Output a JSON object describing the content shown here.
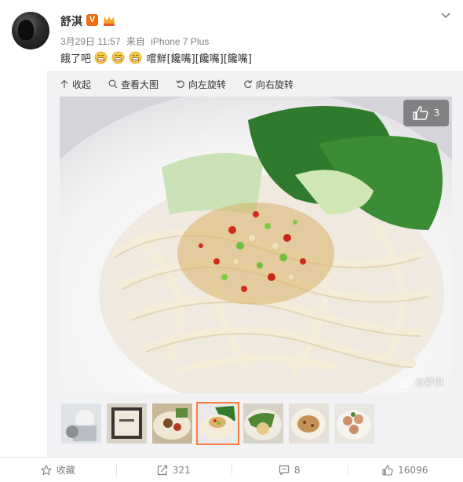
{
  "post": {
    "user": {
      "name": "舒淇",
      "verified_badge": "V"
    },
    "meta": {
      "date": "3月29日 11:57",
      "source_prefix": "来自",
      "device": "iPhone 7 Plus"
    },
    "text_parts": [
      "餓了吧",
      "嚐鮮[饞嘴][饞嘴][饞嘴]"
    ],
    "emoji": "grin-emoji"
  },
  "toolbar": {
    "collapse": "收起",
    "view_large": "查看大图",
    "rotate_left": "向左旋转",
    "rotate_right": "向右旋转"
  },
  "photo": {
    "like_count": "3",
    "watermark": "@舒淇",
    "selected_index": 3,
    "thumbnail_count": 7
  },
  "footer": {
    "favorite_label": "收藏",
    "repost_count": "321",
    "comment_count": "8",
    "like_count": "16096"
  },
  "colors": {
    "accent": "#fa7d3c",
    "badge": "#f26b10",
    "muted_text": "#808080"
  }
}
